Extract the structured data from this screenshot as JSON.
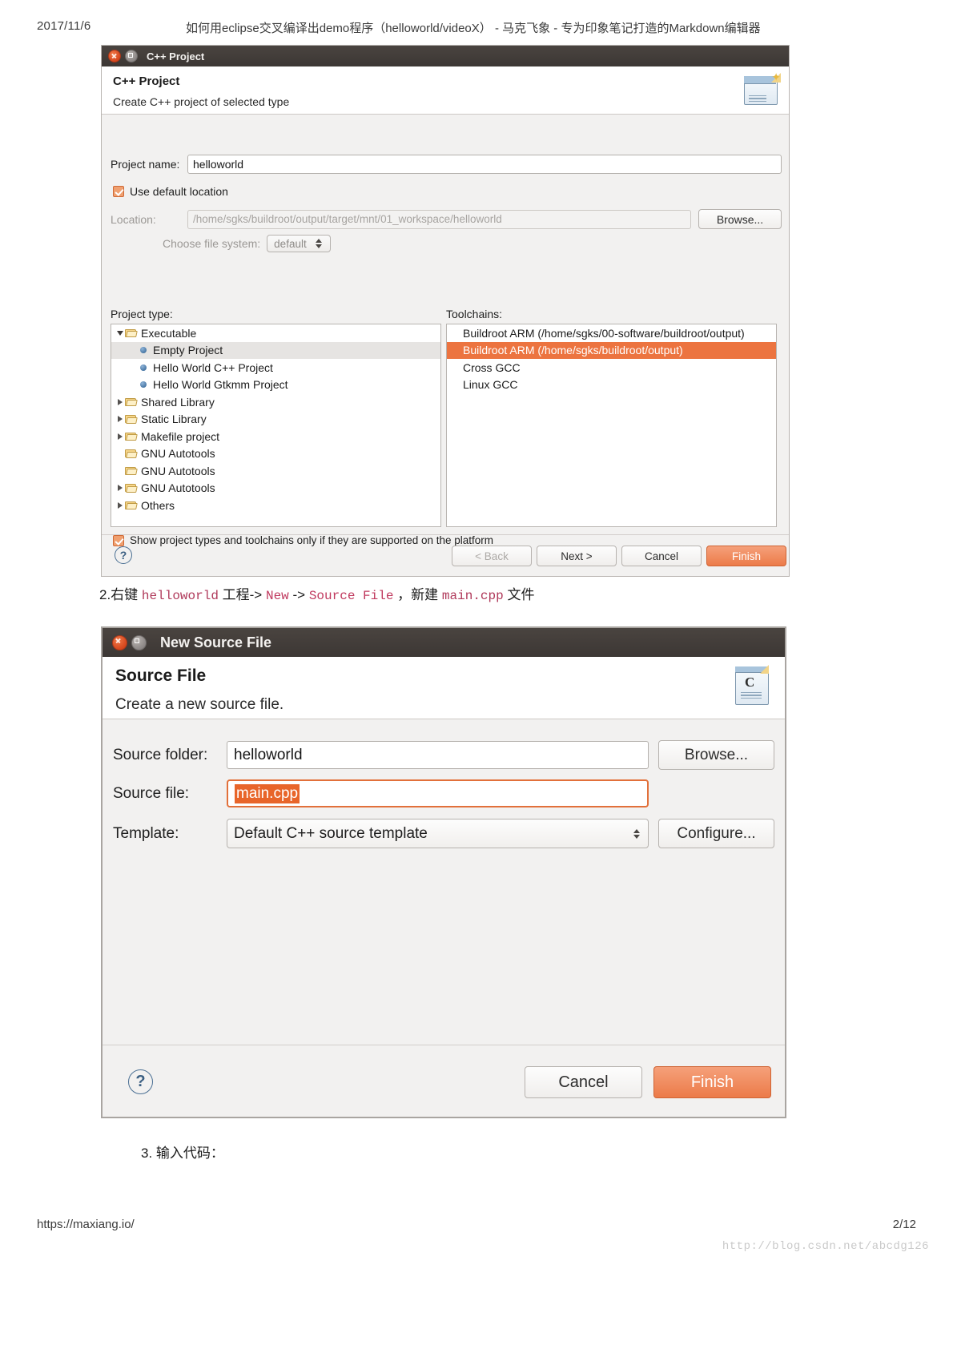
{
  "page": {
    "date": "2017/11/6",
    "doc_title": "如何用eclipse交叉编译出demo程序（helloworld/videoX）  - 马克飞象 - 专为印象笔记打造的Markdown编辑器",
    "footer_url": "https://maxiang.io/",
    "page_number": "2/12",
    "watermark": "http://blog.csdn.net/abcdg126"
  },
  "dialog1": {
    "window_title": "C++ Project",
    "header_title": "C++ Project",
    "header_subtitle": "Create C++ project of selected type",
    "project_name_label": "Project name:",
    "project_name_value": "helloworld",
    "use_default_location_label": "Use default location",
    "location_label": "Location:",
    "location_value": "/home/sgks/buildroot/output/target/mnt/01_workspace/helloworld",
    "browse_label": "Browse...",
    "choose_fs_label": "Choose file system:",
    "choose_fs_value": "default",
    "project_type_label": "Project type:",
    "toolchains_label": "Toolchains:",
    "project_types": [
      {
        "label": "Executable",
        "icon": "folder-icon",
        "twisty": "down",
        "depth": 0,
        "selected": false
      },
      {
        "label": "Empty Project",
        "icon": "bullet-icon",
        "twisty": "none",
        "depth": 1,
        "selected": true
      },
      {
        "label": "Hello World C++ Project",
        "icon": "bullet-icon",
        "twisty": "none",
        "depth": 1,
        "selected": false
      },
      {
        "label": "Hello World Gtkmm Project",
        "icon": "bullet-icon",
        "twisty": "none",
        "depth": 1,
        "selected": false
      },
      {
        "label": "Shared Library",
        "icon": "folder-icon",
        "twisty": "right",
        "depth": 0,
        "selected": false
      },
      {
        "label": "Static Library",
        "icon": "folder-icon",
        "twisty": "right",
        "depth": 0,
        "selected": false
      },
      {
        "label": "Makefile project",
        "icon": "folder-icon",
        "twisty": "right",
        "depth": 0,
        "selected": false
      },
      {
        "label": "GNU Autotools",
        "icon": "folder-icon",
        "twisty": "none",
        "depth": 0,
        "selected": false
      },
      {
        "label": "GNU Autotools",
        "icon": "folder-icon",
        "twisty": "none",
        "depth": 0,
        "selected": false
      },
      {
        "label": "GNU Autotools",
        "icon": "folder-icon",
        "twisty": "right",
        "depth": 0,
        "selected": false
      },
      {
        "label": "Others",
        "icon": "folder-icon",
        "twisty": "right",
        "depth": 0,
        "selected": false
      }
    ],
    "toolchains": [
      {
        "label": "Buildroot ARM (/home/sgks/00-software/buildroot/output)",
        "selected": false
      },
      {
        "label": "Buildroot ARM (/home/sgks/buildroot/output)",
        "selected": true
      },
      {
        "label": "Cross GCC",
        "selected": false
      },
      {
        "label": "Linux GCC",
        "selected": false
      }
    ],
    "show_supported_label": "Show project types and toolchains only if they are supported on the platform",
    "buttons": {
      "help": "?",
      "back": "< Back",
      "next": "Next >",
      "cancel": "Cancel",
      "finish": "Finish"
    }
  },
  "instruction2": {
    "prefix": "2.右键 ",
    "code1": "helloworld",
    "mid1": " 工程-> ",
    "code2": "New",
    "mid2": " -> ",
    "code3": "Source File",
    "mid3": " ，新建 ",
    "code4": "main.cpp",
    "suffix": " 文件"
  },
  "dialog2": {
    "window_title": "New Source File",
    "header_title": "Source File",
    "header_subtitle": "Create a new source file.",
    "source_folder_label": "Source folder:",
    "source_folder_value": "helloworld",
    "browse_label": "Browse...",
    "source_file_label": "Source file:",
    "source_file_value": "main.cpp",
    "template_label": "Template:",
    "template_value": "Default C++ source template",
    "configure_label": "Configure...",
    "buttons": {
      "help": "?",
      "cancel": "Cancel",
      "finish": "Finish"
    }
  },
  "instruction3": {
    "text": "3. 输入代码："
  },
  "colors": {
    "accent_orange": "#ec7440",
    "selection_orange": "#e8652a",
    "titlebar_dark": "#3c3734",
    "code_red": "#b03a5b"
  }
}
